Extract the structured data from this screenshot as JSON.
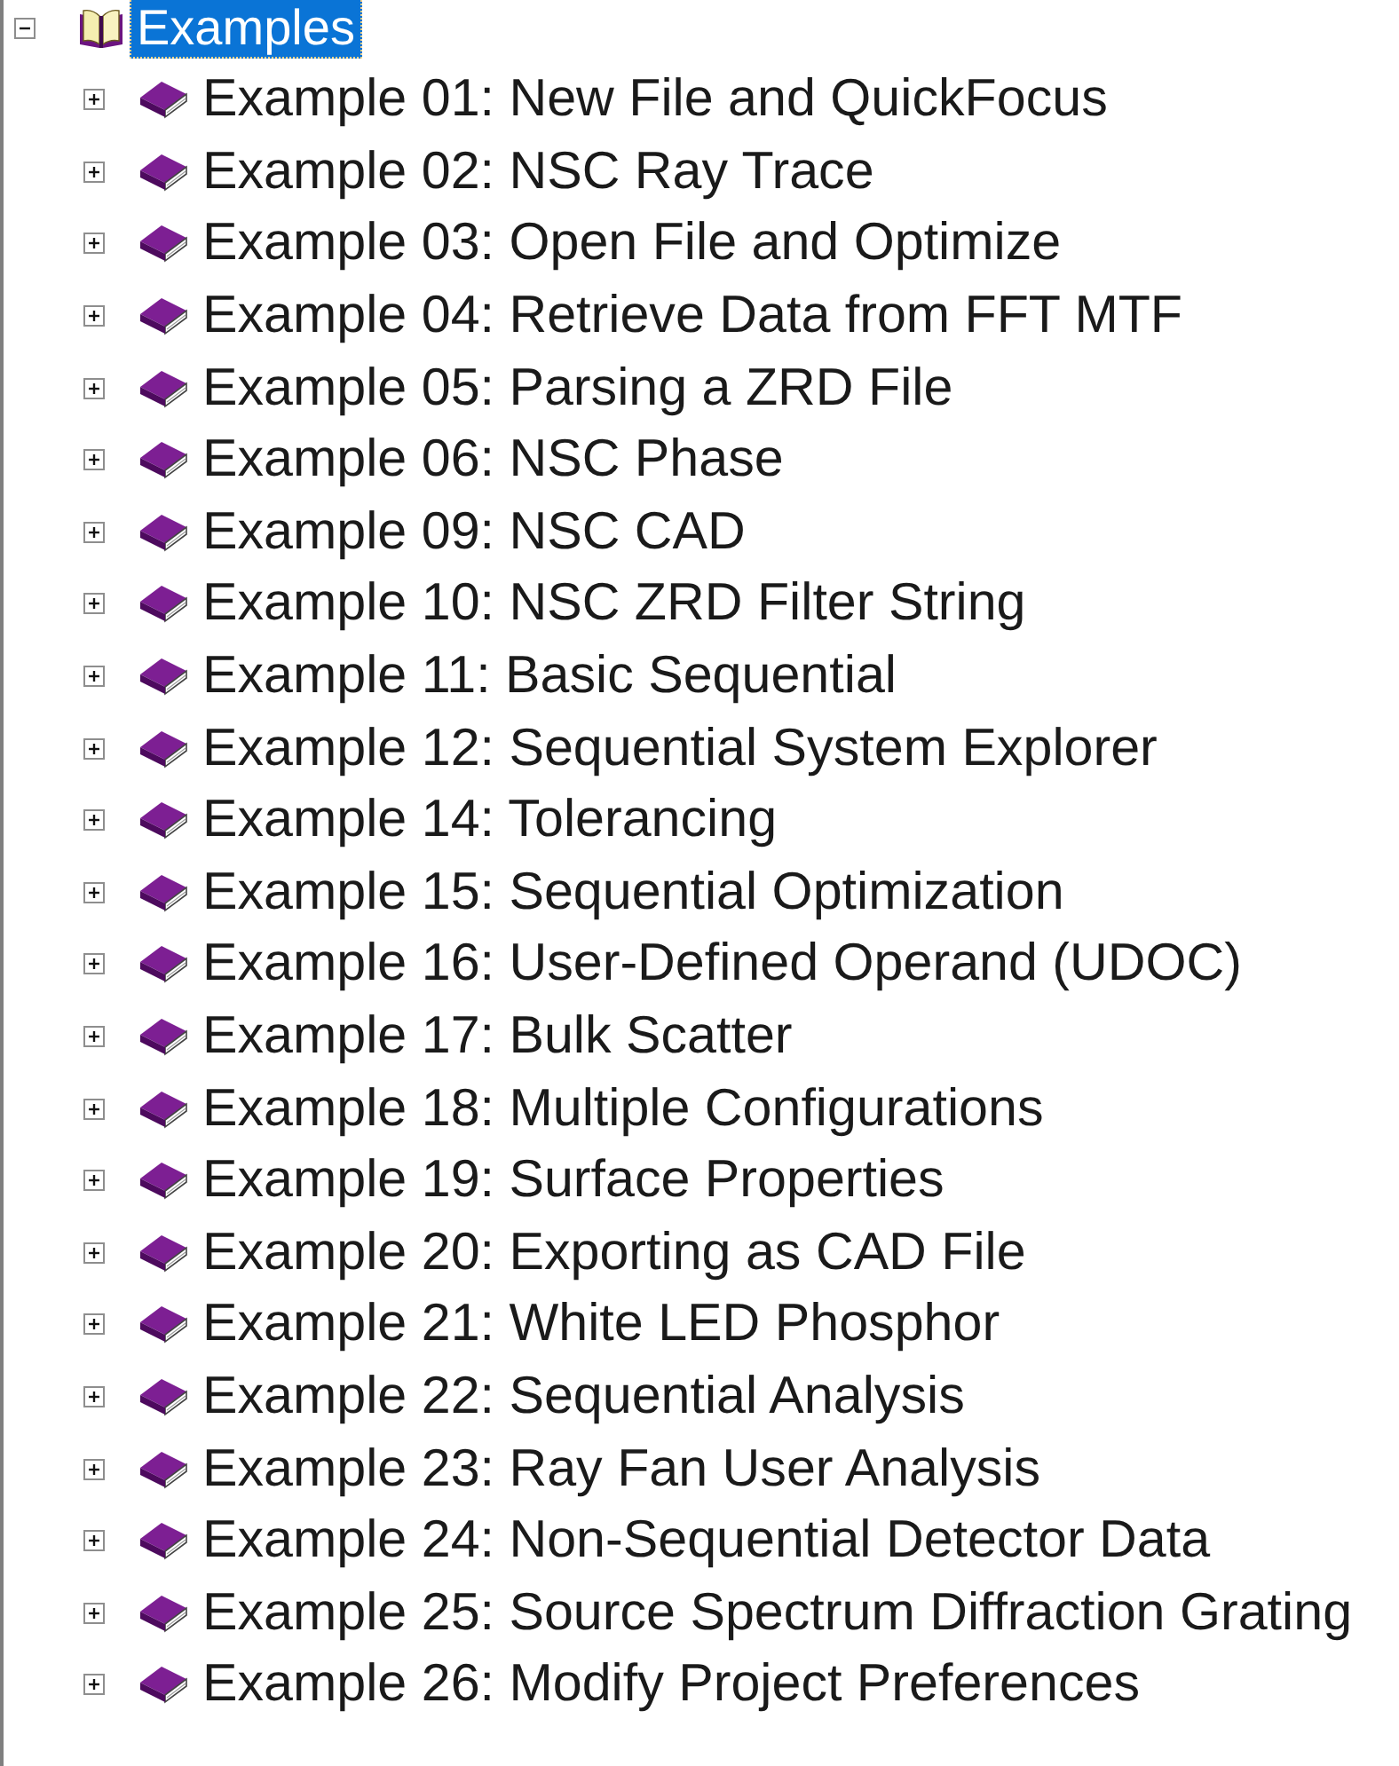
{
  "tree": {
    "root": {
      "label": "Examples",
      "expanded": true,
      "selected": true,
      "children": [
        {
          "label": "Example 01: New File and QuickFocus",
          "expanded": false,
          "selected": false
        },
        {
          "label": "Example 02: NSC Ray Trace",
          "expanded": false,
          "selected": false
        },
        {
          "label": "Example 03: Open File and Optimize",
          "expanded": false,
          "selected": false
        },
        {
          "label": "Example 04: Retrieve Data from FFT MTF",
          "expanded": false,
          "selected": false
        },
        {
          "label": "Example 05: Parsing a ZRD File",
          "expanded": false,
          "selected": false
        },
        {
          "label": "Example 06: NSC Phase",
          "expanded": false,
          "selected": false
        },
        {
          "label": "Example 09: NSC CAD",
          "expanded": false,
          "selected": false
        },
        {
          "label": "Example 10: NSC ZRD Filter String",
          "expanded": false,
          "selected": false
        },
        {
          "label": "Example 11: Basic Sequential",
          "expanded": false,
          "selected": false
        },
        {
          "label": "Example 12: Sequential System Explorer",
          "expanded": false,
          "selected": false
        },
        {
          "label": "Example 14: Tolerancing",
          "expanded": false,
          "selected": false
        },
        {
          "label": "Example 15: Sequential Optimization",
          "expanded": false,
          "selected": false
        },
        {
          "label": "Example 16: User-Defined Operand (UDOC)",
          "expanded": false,
          "selected": false
        },
        {
          "label": "Example 17: Bulk Scatter",
          "expanded": false,
          "selected": false
        },
        {
          "label": "Example 18: Multiple Configurations",
          "expanded": false,
          "selected": false
        },
        {
          "label": "Example 19: Surface Properties",
          "expanded": false,
          "selected": false
        },
        {
          "label": "Example 20: Exporting as CAD File",
          "expanded": false,
          "selected": false
        },
        {
          "label": "Example 21: White LED Phosphor",
          "expanded": false,
          "selected": false
        },
        {
          "label": "Example 22: Sequential Analysis",
          "expanded": false,
          "selected": false
        },
        {
          "label": "Example 23: Ray Fan User Analysis",
          "expanded": false,
          "selected": false
        },
        {
          "label": "Example 24: Non-Sequential Detector Data",
          "expanded": false,
          "selected": false
        },
        {
          "label": "Example 25: Source Spectrum Diffraction Grating",
          "expanded": false,
          "selected": false
        },
        {
          "label": "Example 26: Modify Project Preferences",
          "expanded": false,
          "selected": false
        }
      ]
    }
  }
}
